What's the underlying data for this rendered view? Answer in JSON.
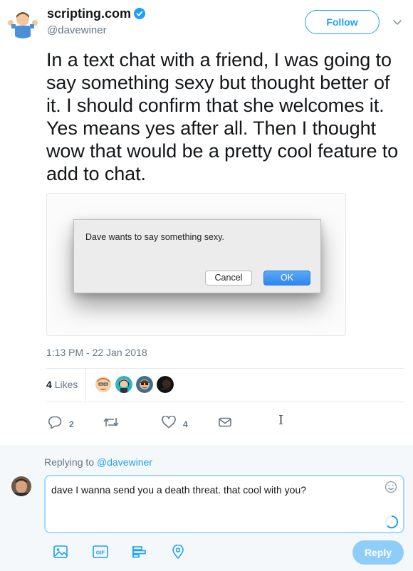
{
  "author": {
    "display_name": "scripting.com",
    "handle": "@davewiner",
    "verified": true
  },
  "header": {
    "follow_label": "Follow"
  },
  "tweet": {
    "text": "In a text chat with a friend, I was going to say something sexy but thought better of it. I should confirm that she welcomes it. Yes means yes after all. Then I thought wow that would be a pretty cool feature to add to chat.",
    "timestamp": "1:13 PM - 22 Jan 2018"
  },
  "media": {
    "dialog_message": "Dave wants to say something sexy.",
    "cancel_label": "Cancel",
    "ok_label": "OK"
  },
  "stats": {
    "likes_count": "4",
    "likes_label": "Likes"
  },
  "actions": {
    "reply_count": "2",
    "like_count": "4"
  },
  "reply": {
    "replying_prefix": "Replying to",
    "replying_handle": "@davewiner",
    "draft_text": "dave I wanna send you a death threat. that cool with you?",
    "reply_button_label": "Reply",
    "gif_label": "GIF"
  },
  "colors": {
    "accent": "#1da1f2",
    "muted": "#657786",
    "reply_button": "#8ecdf8"
  },
  "icons": [
    "verified-badge-icon",
    "chevron-down-icon",
    "reply-icon",
    "retweet-icon",
    "heart-icon",
    "envelope-icon",
    "emoji-icon",
    "loading-spinner-icon",
    "image-icon",
    "gif-icon",
    "poll-icon",
    "location-icon"
  ]
}
